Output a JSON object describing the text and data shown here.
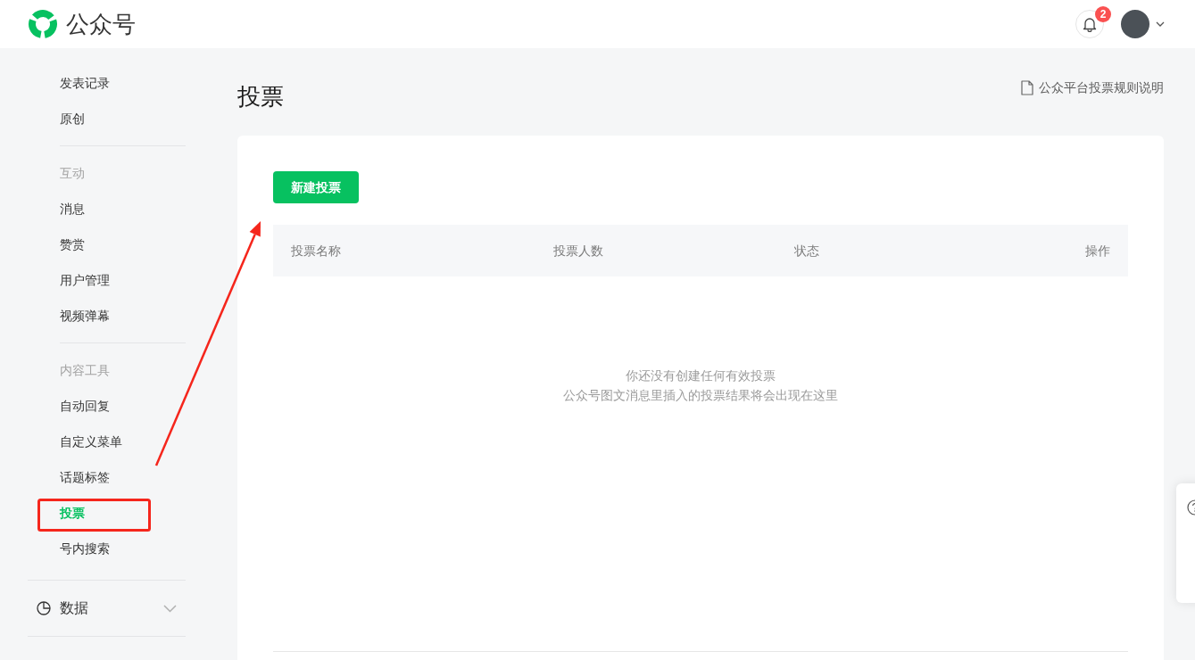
{
  "header": {
    "logo_text": "公众号",
    "notification_count": "2"
  },
  "sidebar": {
    "sections": [
      {
        "items": [
          {
            "label": "发表记录",
            "selected": false
          },
          {
            "label": "原创",
            "selected": false
          }
        ]
      },
      {
        "heading": "互动",
        "items": [
          {
            "label": "消息",
            "selected": false
          },
          {
            "label": "赞赏",
            "selected": false
          },
          {
            "label": "用户管理",
            "selected": false
          },
          {
            "label": "视频弹幕",
            "selected": false
          }
        ]
      },
      {
        "heading": "内容工具",
        "items": [
          {
            "label": "自动回复",
            "selected": false
          },
          {
            "label": "自定义菜单",
            "selected": false
          },
          {
            "label": "话题标签",
            "selected": false
          },
          {
            "label": "投票",
            "selected": true
          },
          {
            "label": "号内搜索",
            "selected": false
          }
        ]
      }
    ],
    "groups": [
      {
        "label": "数据",
        "expanded": false
      }
    ]
  },
  "main": {
    "title": "投票",
    "help_link": "公众平台投票规则说明",
    "new_button": "新建投票",
    "table": {
      "columns": [
        "投票名称",
        "投票人数",
        "状态",
        "操作"
      ],
      "empty_message": [
        "你还没有创建任何有效投票",
        "公众号图文消息里插入的投票结果将会出现在这里"
      ]
    }
  },
  "annotations": {
    "highlight_frame": true,
    "arrow": true
  }
}
